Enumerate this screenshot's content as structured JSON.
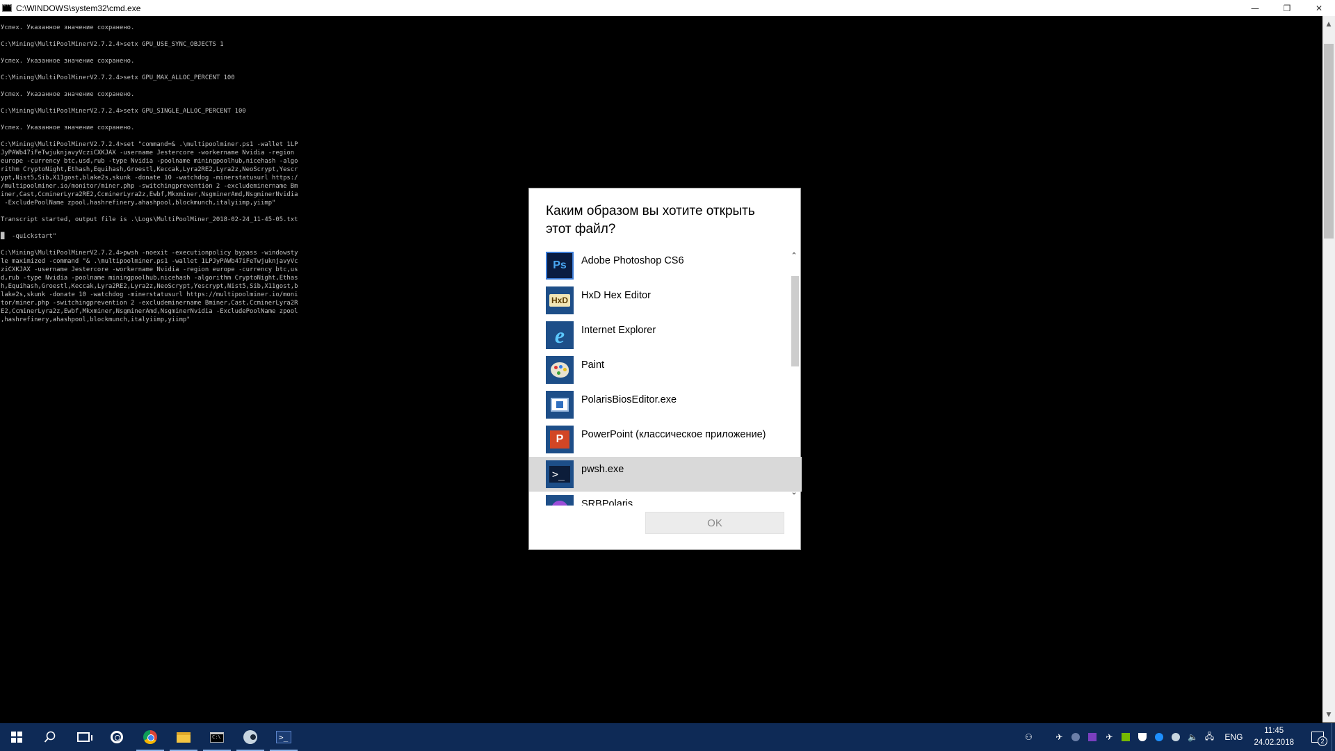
{
  "window": {
    "title": "C:\\WINDOWS\\system32\\cmd.exe",
    "minimize": "—",
    "restore": "❐",
    "close": "✕"
  },
  "console": {
    "text": "Успех. Указанное значение сохранено.\n\nC:\\Mining\\MultiPoolMinerV2.7.2.4>setx GPU_USE_SYNC_OBJECTS 1\n\nУспех. Указанное значение сохранено.\n\nC:\\Mining\\MultiPoolMinerV2.7.2.4>setx GPU_MAX_ALLOC_PERCENT 100\n\nУспех. Указанное значение сохранено.\n\nC:\\Mining\\MultiPoolMinerV2.7.2.4>setx GPU_SINGLE_ALLOC_PERCENT 100\n\nУспех. Указанное значение сохранено.\n\nC:\\Mining\\MultiPoolMinerV2.7.2.4>set \"command=& .\\multipoolminer.ps1 -wallet 1LP\nJyPAWb47iFeTwjuknjavyVcziCXKJAX -username Jestercore -workername Nvidia -region\neurope -currency btc,usd,rub -type Nvidia -poolname miningpoolhub,nicehash -algo\nrithm CryptoNight,Ethash,Equihash,Groestl,Keccak,Lyra2RE2,Lyra2z,NeoScrypt,Yescr\nypt,Nist5,Sib,X11gost,blake2s,skunk -donate 10 -watchdog -minerstatusurl https:/\n/multipoolminer.io/monitor/miner.php -switchingprevention 2 -excludeminername Bm\niner,Cast,CcminerLyra2RE2,CcminerLyra2z,Ewbf,Mkxminer,NsgminerAmd,NsgminerNvidia\n -ExcludePoolName zpool,hashrefinery,ahashpool,blockmunch,italyiimp,yiimp\"\n\nTranscript started, output file is .\\Logs\\MultiPoolMiner_2018-02-24_11-45-05.txt\n\n█  -quickstart\"\n\nC:\\Mining\\MultiPoolMinerV2.7.2.4>pwsh -noexit -executionpolicy bypass -windowsty\nle maximized -command \"& .\\multipoolminer.ps1 -wallet 1LPJyPAWb47iFeTwjuknjavyVc\nziCXKJAX -username Jestercore -workername Nvidia -region europe -currency btc,us\nd,rub -type Nvidia -poolname miningpoolhub,nicehash -algorithm CryptoNight,Ethas\nh,Equihash,Groestl,Keccak,Lyra2RE2,Lyra2z,NeoScrypt,Yescrypt,Nist5,Sib,X11gost,b\nlake2s,skunk -donate 10 -watchdog -minerstatusurl https://multipoolminer.io/moni\ntor/miner.php -switchingprevention 2 -excludeminername Bminer,Cast,CcminerLyra2R\nE2,CcminerLyra2z,Ewbf,Mkxminer,NsgminerAmd,NsgminerNvidia -ExcludePoolName zpool\n,hashrefinery,ahashpool,blockmunch,italyiimp,yiimp\""
  },
  "dialog": {
    "heading": "Каким образом вы хотите открыть этот файл?",
    "ok_label": "OK",
    "apps": [
      {
        "label": "Adobe Photoshop CS6",
        "icon": "photoshop-icon",
        "glyph": "Ps"
      },
      {
        "label": "HxD Hex Editor",
        "icon": "hxd-icon",
        "glyph": "HxD"
      },
      {
        "label": "Internet Explorer",
        "icon": "internet-explorer-icon",
        "glyph": "e"
      },
      {
        "label": "Paint",
        "icon": "paint-icon",
        "glyph": ""
      },
      {
        "label": "PolarisBiosEditor.exe",
        "icon": "polaris-icon",
        "glyph": ""
      },
      {
        "label": "PowerPoint (классическое приложение)",
        "icon": "powerpoint-icon",
        "glyph": "P"
      },
      {
        "label": "pwsh.exe",
        "icon": "pwsh-icon",
        "glyph": ">_"
      },
      {
        "label": "SRBPolaris",
        "icon": "srbpolaris-icon",
        "glyph": ""
      }
    ],
    "selected_index": 6
  },
  "taskbar": {
    "language": "ENG",
    "time": "11:45",
    "date": "24.02.2018",
    "notification_count": "2"
  }
}
